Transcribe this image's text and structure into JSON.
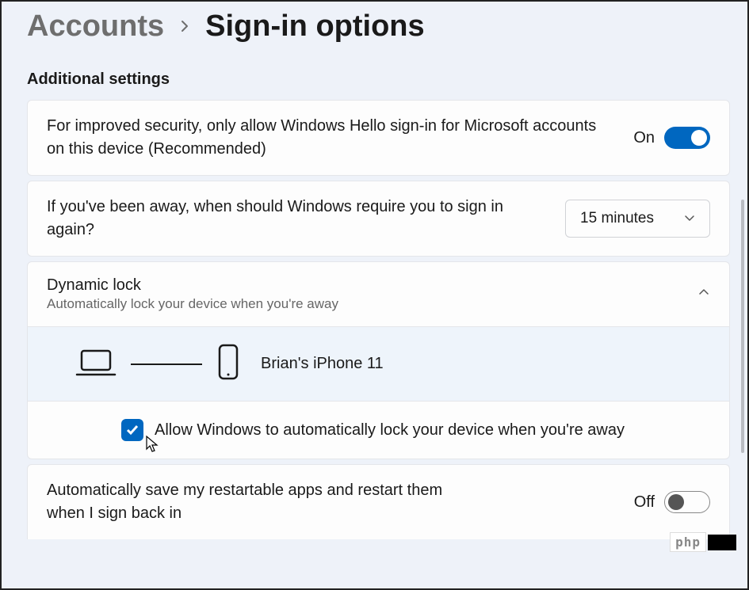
{
  "breadcrumb": {
    "parent": "Accounts",
    "current": "Sign-in options"
  },
  "section_title": "Additional settings",
  "hello_signin": {
    "text": "For improved security, only allow Windows Hello sign-in for Microsoft accounts on this device (Recommended)",
    "state_label": "On",
    "enabled": true
  },
  "require_signin": {
    "text": "If you've been away, when should Windows require you to sign in again?",
    "selected": "15 minutes"
  },
  "dynamic_lock": {
    "title": "Dynamic lock",
    "subtitle": "Automatically lock your device when you're away",
    "expanded": true,
    "device_name": "Brian's iPhone 11",
    "checkbox_label": "Allow Windows to automatically lock your device when you're away",
    "checkbox_checked": true
  },
  "restartable_apps": {
    "text": "Automatically save my restartable apps and restart them when I sign back in",
    "state_label": "Off",
    "enabled": false
  },
  "watermark": {
    "text": "php"
  }
}
